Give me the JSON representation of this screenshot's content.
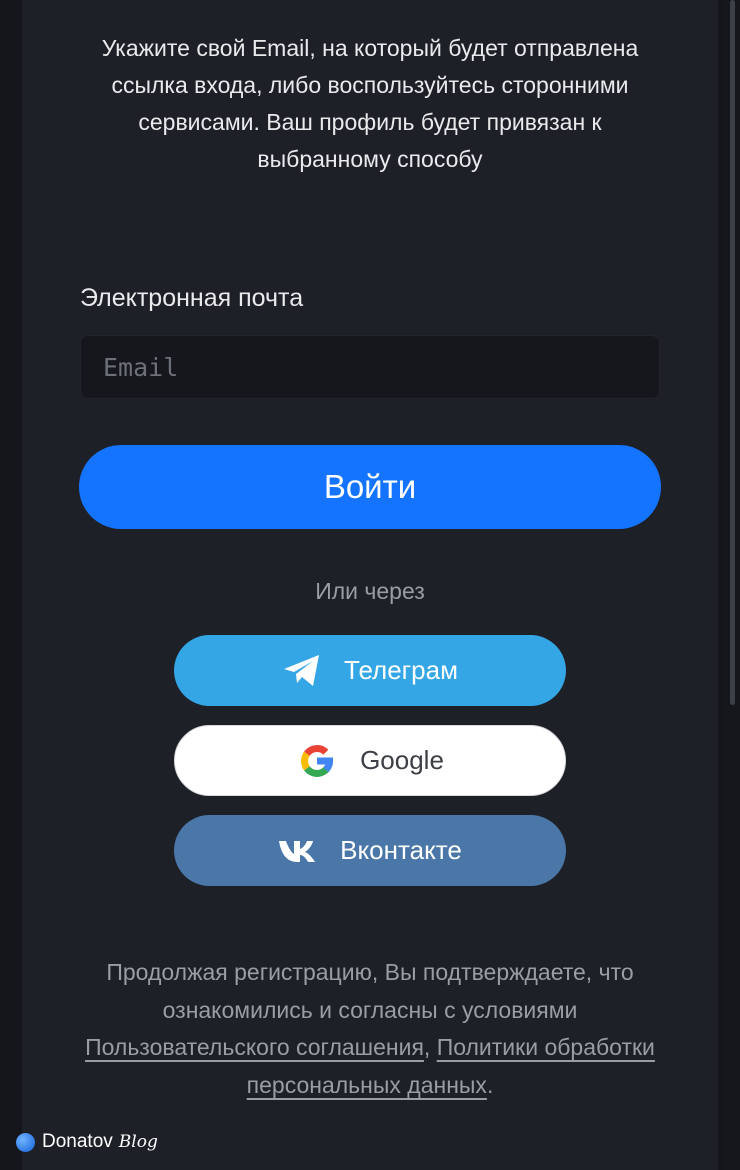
{
  "intro": {
    "text": "Укажите свой Email, на который будет отправлена ссылка входа, либо воспользуйтесь сторонними сервисами. Ваш профиль будет привязан к выбранному способу"
  },
  "email": {
    "label": "Электронная почта",
    "placeholder": "Email",
    "value": ""
  },
  "login_button": {
    "label": "Войти"
  },
  "divider": {
    "text": "Или через"
  },
  "social": {
    "telegram": {
      "label": "Телеграм",
      "icon": "paper-plane-icon",
      "color": "#34a6e6"
    },
    "google": {
      "label": "Google",
      "icon": "google-g-icon",
      "color": "#ffffff"
    },
    "vk": {
      "label": "Вконтакте",
      "icon": "vk-logo-icon",
      "color": "#4a77a8"
    }
  },
  "legal": {
    "prefix": "Продолжая регистрацию, Вы подтверждаете, что ознакомились и согласны с условиями ",
    "agreement_link": "Пользовательского соглашения",
    "separator": ", ",
    "privacy_link": "Политики обработки персональных данных",
    "suffix": "."
  },
  "watermark": {
    "brand": "Donatov",
    "suffix": "Blog"
  },
  "colors": {
    "background": "#1d2027",
    "accent": "#1574ff",
    "text": "#e9eaec",
    "muted": "#9a9da4"
  }
}
